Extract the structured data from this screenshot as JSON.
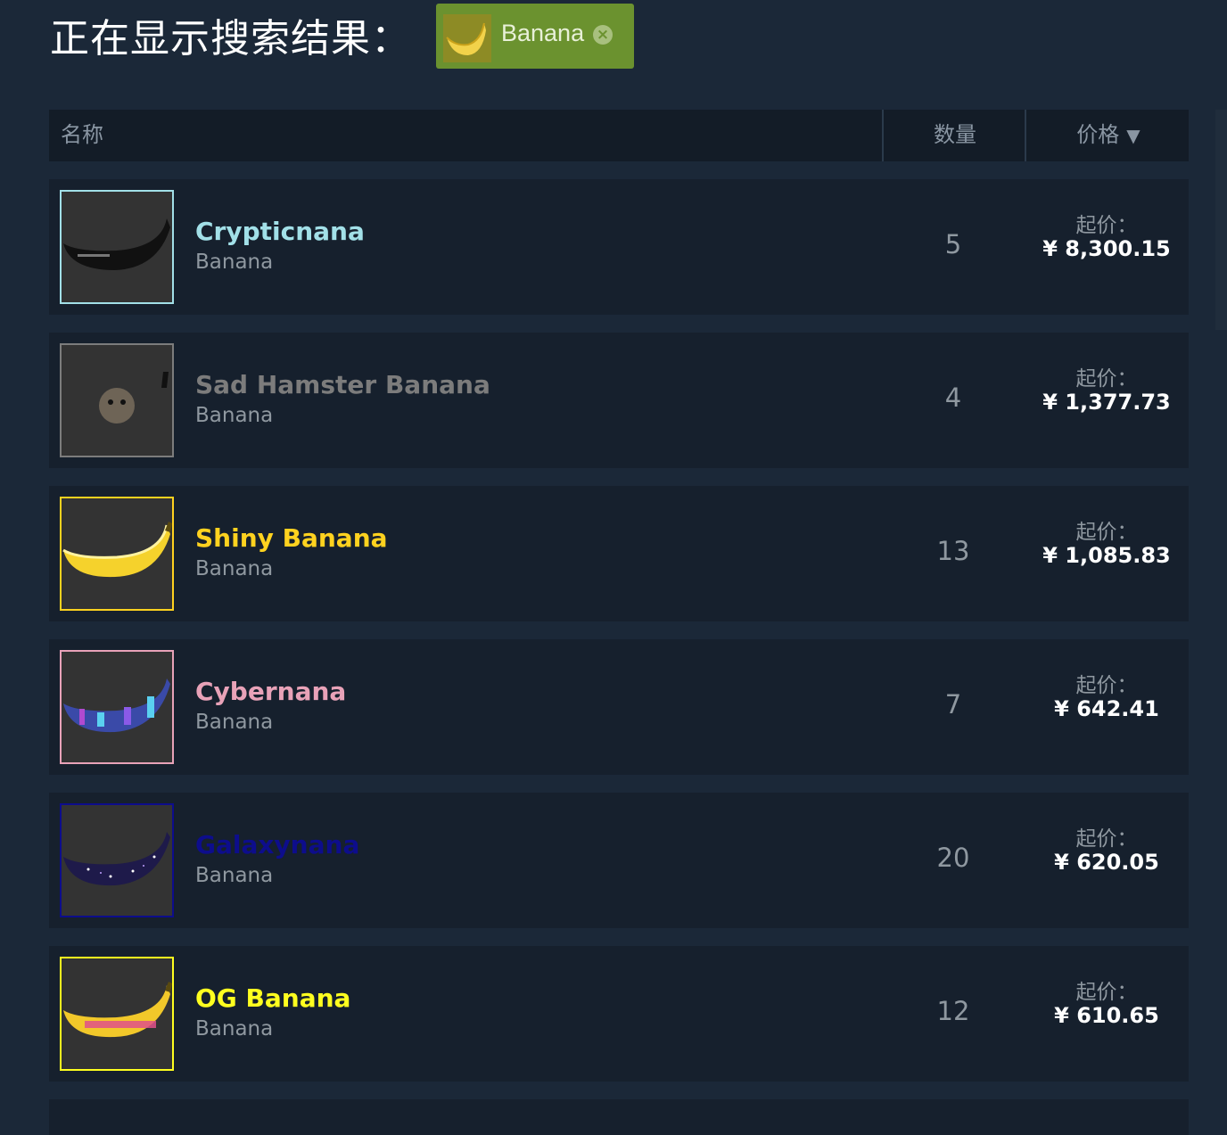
{
  "header": {
    "title": "正在显示搜索结果：",
    "filter_tag": {
      "label": "Banana",
      "close_icon": "×"
    }
  },
  "table": {
    "columns": {
      "name": "名称",
      "quantity": "数量",
      "price": "价格",
      "sort_icon": "▼"
    },
    "price_prefix": "起价：",
    "rows": [
      {
        "name": "Crypticnana",
        "type": "Banana",
        "quantity": "5",
        "price": "¥ 8,300.15",
        "name_color": "#a2e0e8",
        "border_color": "#a2e0e8",
        "icon": "black-banana-icon"
      },
      {
        "name": "Sad Hamster Banana",
        "type": "Banana",
        "quantity": "4",
        "price": "¥ 1,377.73",
        "name_color": "#7c7c7c",
        "border_color": "#7c7c7c",
        "icon": "hamster-icon"
      },
      {
        "name": "Shiny Banana",
        "type": "Banana",
        "quantity": "13",
        "price": "¥ 1,085.83",
        "name_color": "#ffd21f",
        "border_color": "#ffd21f",
        "icon": "yellow-banana-icon"
      },
      {
        "name": "Cybernana",
        "type": "Banana",
        "quantity": "7",
        "price": "¥ 642.41",
        "name_color": "#e8a2b8",
        "border_color": "#e8a2b8",
        "icon": "cyber-banana-icon"
      },
      {
        "name": "Galaxynana",
        "type": "Banana",
        "quantity": "20",
        "price": "¥ 620.05",
        "name_color": "#0d0d8c",
        "border_color": "#0d0d8c",
        "icon": "galaxy-banana-icon"
      },
      {
        "name": "OG Banana",
        "type": "Banana",
        "quantity": "12",
        "price": "¥ 610.65",
        "name_color": "#ffff1f",
        "border_color": "#ffff1f",
        "icon": "og-banana-icon"
      }
    ]
  }
}
